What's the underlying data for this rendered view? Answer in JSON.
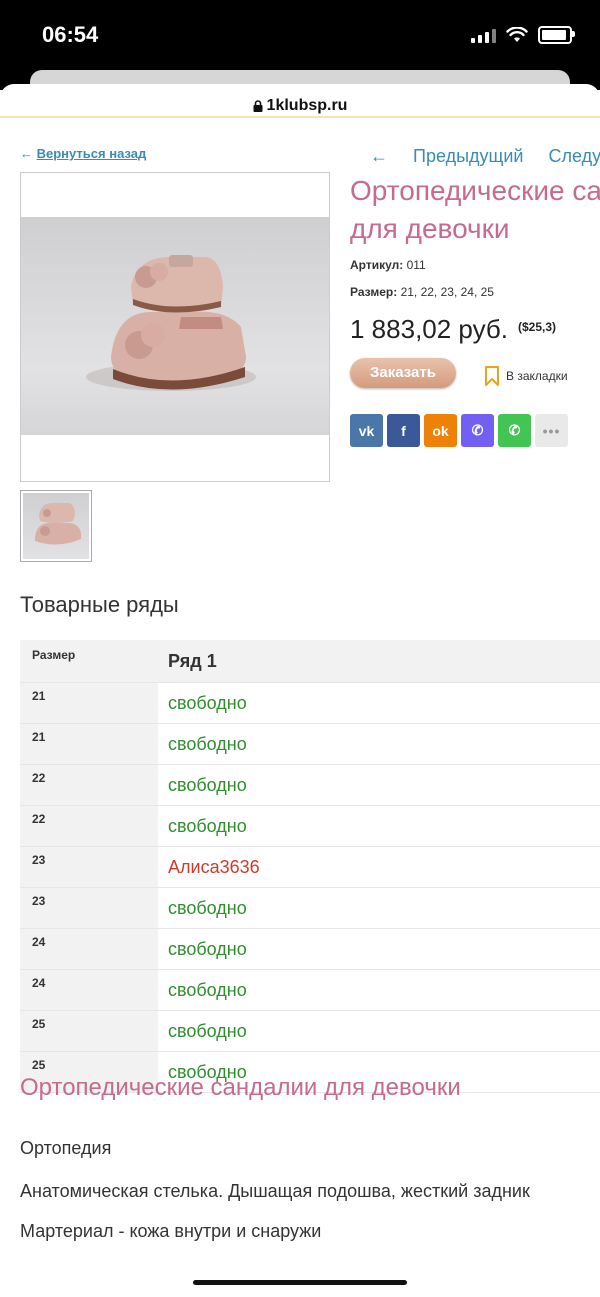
{
  "status_bar": {
    "time": "06:54"
  },
  "browser": {
    "url": "1klubsp.ru"
  },
  "nav": {
    "back_link": "Вернуться назад",
    "back_arrow": "←",
    "prev_arrow": "←",
    "prev_label": "Предыдущий",
    "next_label": "Следующий"
  },
  "product": {
    "title_line1": "Ортопедические сандалии",
    "title_line2": "для девочки",
    "article_label": "Артикул:",
    "article_value": "011",
    "size_label": "Размер:",
    "size_value": "21, 22, 23, 24, 25",
    "price": "1 883,02 руб.",
    "price_alt": "($25,3)",
    "order_button": "Заказать",
    "bookmark_label": "В закладки"
  },
  "share": [
    {
      "name": "vk-icon",
      "glyph": "vk",
      "color": "#4a76a8"
    },
    {
      "name": "facebook-icon",
      "glyph": "f",
      "color": "#3b5998"
    },
    {
      "name": "odnoklassniki-icon",
      "glyph": "ok",
      "color": "#ee8208"
    },
    {
      "name": "viber-icon",
      "glyph": "✆",
      "color": "#7360f2"
    },
    {
      "name": "whatsapp-icon",
      "glyph": "✆",
      "color": "#43c553"
    },
    {
      "name": "more-icon",
      "glyph": "•••",
      "color": "#e9e9e9"
    }
  ],
  "rows_section": {
    "title": "Товарные ряды",
    "col_size": "Размер",
    "col_row": "Ряд 1",
    "rows": [
      {
        "size": "21",
        "status": "свободно",
        "taken": false
      },
      {
        "size": "21",
        "status": "свободно",
        "taken": false
      },
      {
        "size": "22",
        "status": "свободно",
        "taken": false
      },
      {
        "size": "22",
        "status": "свободно",
        "taken": false
      },
      {
        "size": "23",
        "status": "Алиса3636",
        "taken": true
      },
      {
        "size": "23",
        "status": "свободно",
        "taken": false
      },
      {
        "size": "24",
        "status": "свободно",
        "taken": false
      },
      {
        "size": "24",
        "status": "свободно",
        "taken": false
      },
      {
        "size": "25",
        "status": "свободно",
        "taken": false
      },
      {
        "size": "25",
        "status": "свободно",
        "taken": false
      }
    ]
  },
  "description": {
    "title": "Ортопедические сандалии для девочки",
    "lines": [
      "Ортопедия",
      "Анатомическая стелька. Дышащая подошва, жесткий задник",
      "Мартериал - кожа внутри и снаружи"
    ]
  },
  "colors": {
    "accent_pink": "#c66a8e",
    "link_blue": "#3a8bb5",
    "free_green": "#2f8f2f",
    "taken_red": "#d23a2a"
  }
}
